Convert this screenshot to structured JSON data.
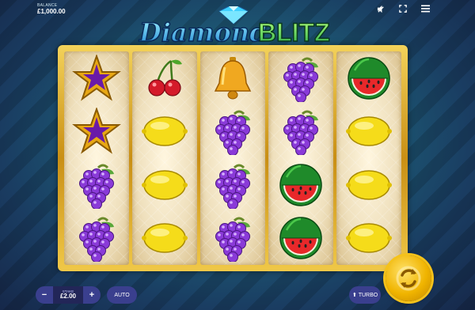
{
  "header": {
    "balance_label": "BALANCE",
    "balance_value": "£1,000.00",
    "icons": [
      "mute-icon",
      "fullscreen-icon",
      "menu-icon"
    ]
  },
  "logo": {
    "word1": "Diamond",
    "word2": "BLITZ"
  },
  "reels": [
    [
      "star",
      "star",
      "grapes",
      "grapes"
    ],
    [
      "cherries",
      "lemon",
      "lemon",
      "lemon"
    ],
    [
      "bell",
      "grapes",
      "grapes",
      "grapes"
    ],
    [
      "grapes",
      "grapes",
      "watermelon",
      "watermelon"
    ],
    [
      "watermelon",
      "lemon",
      "lemon",
      "lemon"
    ]
  ],
  "controls": {
    "stake_label": "STAKE",
    "stake_value": "£2.00",
    "minus": "−",
    "plus": "+",
    "auto_label": "AUTO",
    "turbo_label": "TURBO"
  },
  "colors": {
    "frame_gold": "#e2b32c",
    "button_blue": "#3a3f8e",
    "spin_gold": "#f0b400"
  }
}
